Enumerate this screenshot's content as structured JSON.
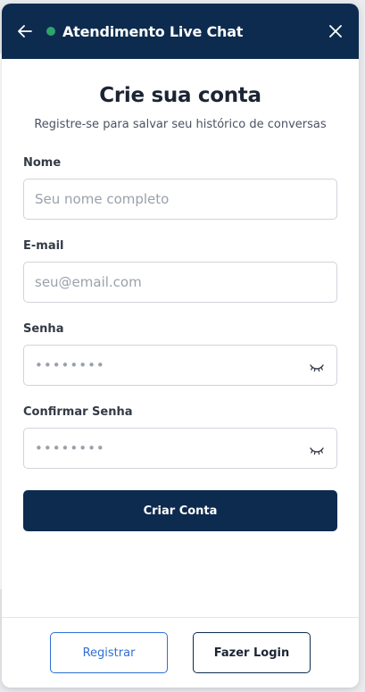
{
  "colors": {
    "header_bg": "#0d2b4e",
    "status_online": "#2ea36b",
    "primary": "#0d2b4e",
    "accent_blue": "#2f6fd6"
  },
  "header": {
    "title": "Atendimento Live Chat",
    "back_icon": "arrow-left-icon",
    "close_icon": "close-icon"
  },
  "form": {
    "title": "Crie sua conta",
    "subtitle": "Registre-se para salvar seu histórico de conversas",
    "name": {
      "label": "Nome",
      "placeholder": "Seu nome completo",
      "value": ""
    },
    "email": {
      "label": "E-mail",
      "placeholder": "seu@email.com",
      "value": ""
    },
    "password": {
      "label": "Senha",
      "placeholder": "••••••••",
      "value": "",
      "icon": "eye-closed-icon"
    },
    "confirm_password": {
      "label": "Confirmar Senha",
      "placeholder": "••••••••",
      "value": "",
      "icon": "eye-closed-icon"
    },
    "submit_label": "Criar Conta"
  },
  "footer": {
    "register_label": "Registrar",
    "login_label": "Fazer Login"
  }
}
